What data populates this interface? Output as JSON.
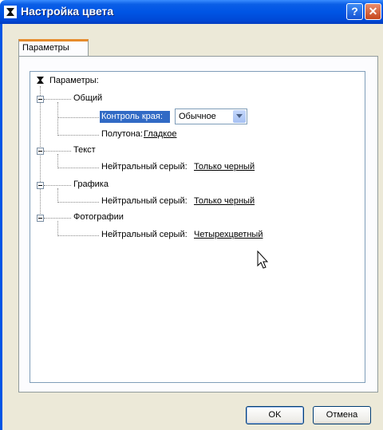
{
  "window": {
    "title": "Настройка цвета",
    "help_label": "?",
    "close_label": "✕"
  },
  "tab": {
    "label": "Параметры"
  },
  "tree": {
    "root_label": "Параметры:",
    "groups": [
      {
        "label": "Общий",
        "items": [
          {
            "label": "Контроль края:",
            "value": "Обычное",
            "type": "combo"
          },
          {
            "label": "Полутона:",
            "value": "Гладкое",
            "type": "link"
          }
        ]
      },
      {
        "label": "Текст",
        "items": [
          {
            "label": "Нейтральный серый:",
            "value": "Только черный",
            "type": "link"
          }
        ]
      },
      {
        "label": "Графика",
        "items": [
          {
            "label": "Нейтральный серый:",
            "value": "Только черный",
            "type": "link"
          }
        ]
      },
      {
        "label": "Фотографии",
        "items": [
          {
            "label": "Нейтральный серый:",
            "value": "Четырехцветный",
            "type": "link"
          }
        ]
      }
    ]
  },
  "buttons": {
    "ok": "OK",
    "cancel": "Отмена"
  },
  "colors": {
    "titlebar": "#0055e5",
    "selection": "#316ac5",
    "tab_accent": "#e68b2c",
    "window_bg": "#ece9d8"
  }
}
